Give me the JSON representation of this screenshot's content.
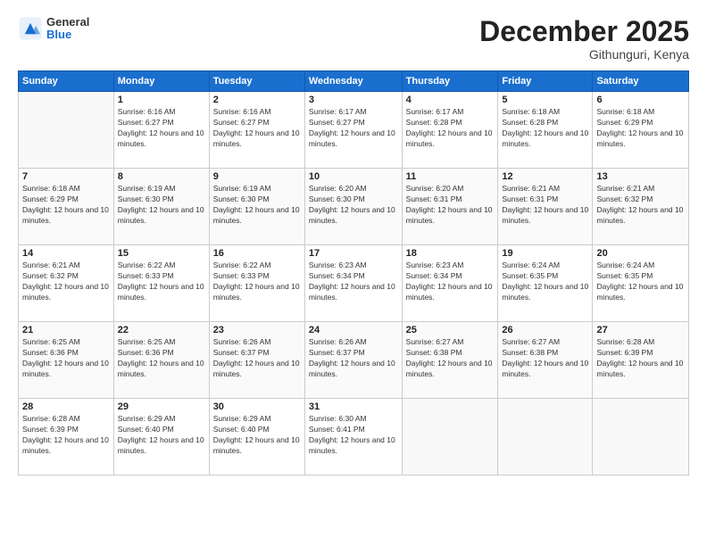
{
  "logo": {
    "general": "General",
    "blue": "Blue"
  },
  "title": "December 2025",
  "subtitle": "Githunguri, Kenya",
  "headers": [
    "Sunday",
    "Monday",
    "Tuesday",
    "Wednesday",
    "Thursday",
    "Friday",
    "Saturday"
  ],
  "weeks": [
    [
      {
        "day": "",
        "info": ""
      },
      {
        "day": "1",
        "info": "Sunrise: 6:16 AM\nSunset: 6:27 PM\nDaylight: 12 hours and 10 minutes."
      },
      {
        "day": "2",
        "info": "Sunrise: 6:16 AM\nSunset: 6:27 PM\nDaylight: 12 hours and 10 minutes."
      },
      {
        "day": "3",
        "info": "Sunrise: 6:17 AM\nSunset: 6:27 PM\nDaylight: 12 hours and 10 minutes."
      },
      {
        "day": "4",
        "info": "Sunrise: 6:17 AM\nSunset: 6:28 PM\nDaylight: 12 hours and 10 minutes."
      },
      {
        "day": "5",
        "info": "Sunrise: 6:18 AM\nSunset: 6:28 PM\nDaylight: 12 hours and 10 minutes."
      },
      {
        "day": "6",
        "info": "Sunrise: 6:18 AM\nSunset: 6:29 PM\nDaylight: 12 hours and 10 minutes."
      }
    ],
    [
      {
        "day": "7",
        "info": "Sunrise: 6:18 AM\nSunset: 6:29 PM\nDaylight: 12 hours and 10 minutes."
      },
      {
        "day": "8",
        "info": "Sunrise: 6:19 AM\nSunset: 6:30 PM\nDaylight: 12 hours and 10 minutes."
      },
      {
        "day": "9",
        "info": "Sunrise: 6:19 AM\nSunset: 6:30 PM\nDaylight: 12 hours and 10 minutes."
      },
      {
        "day": "10",
        "info": "Sunrise: 6:20 AM\nSunset: 6:30 PM\nDaylight: 12 hours and 10 minutes."
      },
      {
        "day": "11",
        "info": "Sunrise: 6:20 AM\nSunset: 6:31 PM\nDaylight: 12 hours and 10 minutes."
      },
      {
        "day": "12",
        "info": "Sunrise: 6:21 AM\nSunset: 6:31 PM\nDaylight: 12 hours and 10 minutes."
      },
      {
        "day": "13",
        "info": "Sunrise: 6:21 AM\nSunset: 6:32 PM\nDaylight: 12 hours and 10 minutes."
      }
    ],
    [
      {
        "day": "14",
        "info": "Sunrise: 6:21 AM\nSunset: 6:32 PM\nDaylight: 12 hours and 10 minutes."
      },
      {
        "day": "15",
        "info": "Sunrise: 6:22 AM\nSunset: 6:33 PM\nDaylight: 12 hours and 10 minutes."
      },
      {
        "day": "16",
        "info": "Sunrise: 6:22 AM\nSunset: 6:33 PM\nDaylight: 12 hours and 10 minutes."
      },
      {
        "day": "17",
        "info": "Sunrise: 6:23 AM\nSunset: 6:34 PM\nDaylight: 12 hours and 10 minutes."
      },
      {
        "day": "18",
        "info": "Sunrise: 6:23 AM\nSunset: 6:34 PM\nDaylight: 12 hours and 10 minutes."
      },
      {
        "day": "19",
        "info": "Sunrise: 6:24 AM\nSunset: 6:35 PM\nDaylight: 12 hours and 10 minutes."
      },
      {
        "day": "20",
        "info": "Sunrise: 6:24 AM\nSunset: 6:35 PM\nDaylight: 12 hours and 10 minutes."
      }
    ],
    [
      {
        "day": "21",
        "info": "Sunrise: 6:25 AM\nSunset: 6:36 PM\nDaylight: 12 hours and 10 minutes."
      },
      {
        "day": "22",
        "info": "Sunrise: 6:25 AM\nSunset: 6:36 PM\nDaylight: 12 hours and 10 minutes."
      },
      {
        "day": "23",
        "info": "Sunrise: 6:26 AM\nSunset: 6:37 PM\nDaylight: 12 hours and 10 minutes."
      },
      {
        "day": "24",
        "info": "Sunrise: 6:26 AM\nSunset: 6:37 PM\nDaylight: 12 hours and 10 minutes."
      },
      {
        "day": "25",
        "info": "Sunrise: 6:27 AM\nSunset: 6:38 PM\nDaylight: 12 hours and 10 minutes."
      },
      {
        "day": "26",
        "info": "Sunrise: 6:27 AM\nSunset: 6:38 PM\nDaylight: 12 hours and 10 minutes."
      },
      {
        "day": "27",
        "info": "Sunrise: 6:28 AM\nSunset: 6:39 PM\nDaylight: 12 hours and 10 minutes."
      }
    ],
    [
      {
        "day": "28",
        "info": "Sunrise: 6:28 AM\nSunset: 6:39 PM\nDaylight: 12 hours and 10 minutes."
      },
      {
        "day": "29",
        "info": "Sunrise: 6:29 AM\nSunset: 6:40 PM\nDaylight: 12 hours and 10 minutes."
      },
      {
        "day": "30",
        "info": "Sunrise: 6:29 AM\nSunset: 6:40 PM\nDaylight: 12 hours and 10 minutes."
      },
      {
        "day": "31",
        "info": "Sunrise: 6:30 AM\nSunset: 6:41 PM\nDaylight: 12 hours and 10 minutes."
      },
      {
        "day": "",
        "info": ""
      },
      {
        "day": "",
        "info": ""
      },
      {
        "day": "",
        "info": ""
      }
    ]
  ]
}
